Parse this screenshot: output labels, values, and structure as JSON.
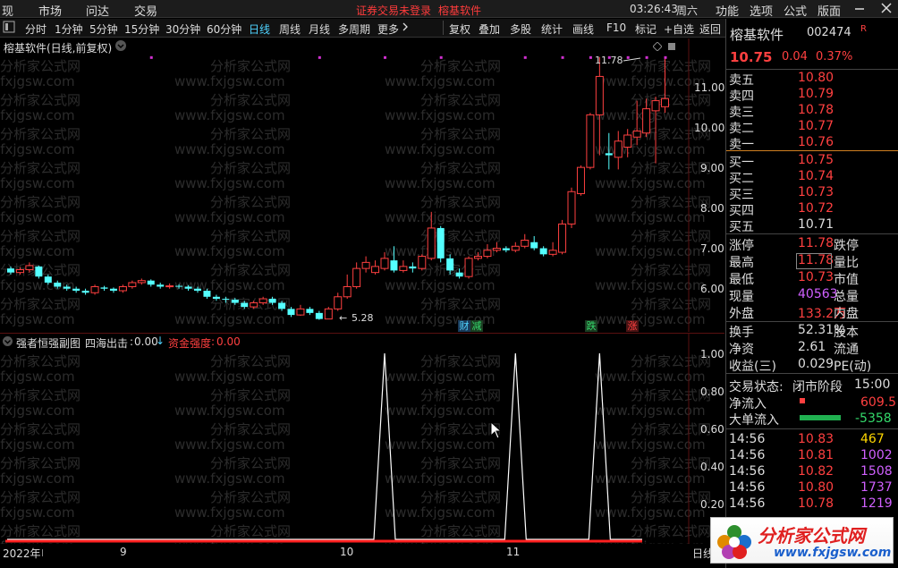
{
  "menubar": {
    "items": [
      "现",
      "市场",
      "问达",
      "交易"
    ],
    "notice": "证券交易未登录",
    "brand": "榕基软件",
    "time": "03:26:43",
    "weekday": "周六",
    "right_items": [
      "功能",
      "选项",
      "公式",
      "版面"
    ],
    "min_icon": "minimize-icon",
    "close_icon": "close-icon"
  },
  "toolbar": {
    "left_icon": "panel-toggle-icon",
    "periods": [
      "分时",
      "1分钟",
      "5分钟",
      "15分钟",
      "30分钟",
      "60分钟",
      "日线",
      "周线",
      "月线",
      "多周期",
      "更多"
    ],
    "active_period": "日线",
    "tools": [
      "复权",
      "叠加",
      "多股",
      "统计",
      "画线",
      "F10",
      "标记",
      "+自选",
      "返回"
    ]
  },
  "main_chart": {
    "title": "榕基软件(日线,前复权)",
    "y_ticks": [
      "11.00",
      "10.00",
      "9.00",
      "8.00",
      "7.00",
      "6.00"
    ],
    "high_label": "11.78",
    "low_label": "5.28",
    "event_tags": [
      {
        "text": "财",
        "color": "#4fd3ff"
      },
      {
        "text": "减",
        "color": "#34d96b"
      },
      {
        "text": "跌",
        "color": "#34d96b"
      },
      {
        "text": "涨",
        "color": "#ff4040"
      }
    ],
    "watermark": [
      "分析家公式网",
      "www.fxjgsw.com"
    ],
    "colors": {
      "up": "#ff4040",
      "down": "#54ffff",
      "marker": "#d030d0"
    }
  },
  "chart_data": {
    "type": "candlestick",
    "title": "榕基软件(日线,前复权)",
    "ylim": [
      5.0,
      12.0
    ],
    "open": [
      6.55,
      6.45,
      6.52,
      6.6,
      6.35,
      6.2,
      6.1,
      6.05,
      6.0,
      5.95,
      6.08,
      6.05,
      6.0,
      6.1,
      6.2,
      6.25,
      6.15,
      6.1,
      6.12,
      6.1,
      6.05,
      6.0,
      5.85,
      5.8,
      5.78,
      5.7,
      5.6,
      5.7,
      5.8,
      5.7,
      5.55,
      5.4,
      5.55,
      5.45,
      5.3,
      5.55,
      5.85,
      6.1,
      6.55,
      6.45,
      6.55,
      6.75,
      6.5,
      6.6,
      6.55,
      6.8,
      7.55,
      6.8,
      6.45,
      6.35,
      6.8,
      6.85,
      7.0,
      7.05,
      7.0,
      7.1,
      7.2,
      7.05,
      6.9,
      6.95,
      7.65,
      8.4,
      9.05,
      10.35,
      9.4,
      9.3,
      9.55,
      9.8,
      9.9,
      10.45,
      10.55
    ],
    "close": [
      6.45,
      6.52,
      6.62,
      6.35,
      6.2,
      6.1,
      6.05,
      6.0,
      5.95,
      6.1,
      6.05,
      6.0,
      6.1,
      6.2,
      6.25,
      6.15,
      6.1,
      6.12,
      6.1,
      6.05,
      6.0,
      5.85,
      5.8,
      5.78,
      5.7,
      5.6,
      5.7,
      5.8,
      5.7,
      5.55,
      5.4,
      5.55,
      5.45,
      5.3,
      5.55,
      5.85,
      6.1,
      6.55,
      6.7,
      6.6,
      6.8,
      6.5,
      6.6,
      6.55,
      6.85,
      7.55,
      6.8,
      6.5,
      6.35,
      6.8,
      6.85,
      7.0,
      7.05,
      7.0,
      7.1,
      7.25,
      7.05,
      6.9,
      7.0,
      7.65,
      8.45,
      9.05,
      10.35,
      11.3,
      9.35,
      9.7,
      9.85,
      9.95,
      10.5,
      10.7,
      10.75
    ],
    "high": [
      6.6,
      6.58,
      6.7,
      6.62,
      6.4,
      6.25,
      6.15,
      6.1,
      6.05,
      6.15,
      6.12,
      6.08,
      6.15,
      6.25,
      6.3,
      6.28,
      6.2,
      6.18,
      6.16,
      6.14,
      6.1,
      6.05,
      5.9,
      5.85,
      5.82,
      5.75,
      5.75,
      5.85,
      5.85,
      5.75,
      5.6,
      5.65,
      5.6,
      5.5,
      5.6,
      5.95,
      6.4,
      6.7,
      6.85,
      6.75,
      6.95,
      7.1,
      6.75,
      6.7,
      6.9,
      7.95,
      7.6,
      6.9,
      6.55,
      6.85,
      6.95,
      7.15,
      7.2,
      7.1,
      7.2,
      7.4,
      7.35,
      7.1,
      7.2,
      7.75,
      8.55,
      9.1,
      10.4,
      11.78,
      9.9,
      9.95,
      10.0,
      10.7,
      10.75,
      10.8,
      11.78
    ],
    "low": [
      6.4,
      6.4,
      6.45,
      6.3,
      6.15,
      6.05,
      6.0,
      5.95,
      5.9,
      5.9,
      6.0,
      5.95,
      5.95,
      6.05,
      6.15,
      6.1,
      6.05,
      6.05,
      6.05,
      6.0,
      5.95,
      5.8,
      5.75,
      5.7,
      5.65,
      5.55,
      5.55,
      5.65,
      5.65,
      5.5,
      5.35,
      5.38,
      5.4,
      5.28,
      5.3,
      5.5,
      5.8,
      6.05,
      6.45,
      6.4,
      6.5,
      6.45,
      6.45,
      6.45,
      6.5,
      6.75,
      6.7,
      6.4,
      6.3,
      6.3,
      6.75,
      6.8,
      6.95,
      6.95,
      6.95,
      7.05,
      7.0,
      6.85,
      6.85,
      6.9,
      7.55,
      8.35,
      9.0,
      9.35,
      9.0,
      9.0,
      9.3,
      9.6,
      9.8,
      9.15,
      10.4
    ],
    "markers_y": 11.8,
    "markers_x": [
      15,
      33,
      40,
      46,
      55,
      59,
      62,
      64,
      66,
      68,
      70
    ]
  },
  "sub_chart": {
    "title": "强者恒强副图",
    "item1_label": "四海出击",
    "item1_value": "0.00",
    "item2_label": "资金强度",
    "item2_value": "0.00",
    "y_ticks": [
      "1.00",
      "0.80",
      "0.60",
      "0.40",
      "0.20"
    ],
    "spikes": [
      {
        "x": 40,
        "value": 1.0
      },
      {
        "x": 54,
        "value": 1.0
      },
      {
        "x": 63,
        "value": 1.0
      }
    ]
  },
  "date_axis": {
    "labels": [
      "2022年",
      "9",
      "10",
      "11"
    ],
    "right_label": "日线"
  },
  "right_panel": {
    "stock_name": "榕基软件",
    "stock_code": "002474",
    "r_badge": "R",
    "price": "10.75",
    "change": "0.04",
    "change_pct": "0.37%",
    "asks": [
      {
        "label": "卖五",
        "price": "10.80"
      },
      {
        "label": "卖四",
        "price": "10.79"
      },
      {
        "label": "卖三",
        "price": "10.78"
      },
      {
        "label": "卖二",
        "price": "10.77"
      },
      {
        "label": "卖一",
        "price": "10.76"
      }
    ],
    "bids": [
      {
        "label": "买一",
        "price": "10.75"
      },
      {
        "label": "买二",
        "price": "10.74"
      },
      {
        "label": "买三",
        "price": "10.73"
      },
      {
        "label": "买四",
        "price": "10.72"
      },
      {
        "label": "买五",
        "price": "10.71"
      }
    ],
    "stats": [
      {
        "label": "涨停",
        "value": "11.78",
        "right": "跌停"
      },
      {
        "label": "最高",
        "value": "11.78",
        "right": "量比"
      },
      {
        "label": "最低",
        "value": "10.73",
        "right": "市值"
      },
      {
        "label": "现量",
        "value": "40563",
        "right": "总量"
      },
      {
        "label": "外盘",
        "value": "133.2万",
        "right": "内盘"
      }
    ],
    "stats2": [
      {
        "label": "换手",
        "value": "52.31%",
        "right": "股本"
      },
      {
        "label": "净资",
        "value": "2.61",
        "right": "流通"
      },
      {
        "label": "收益(三)",
        "value": "0.029",
        "right": "PE(动)"
      }
    ],
    "trade_status_label": "交易状态:",
    "trade_status": "闭市阶段",
    "trade_time": "15:00",
    "net_inflow_label": "净流入",
    "net_inflow": "609.5",
    "big_inflow_label": "大单流入",
    "big_inflow": "-5358",
    "ticks": [
      {
        "time": "14:56",
        "price": "10.83",
        "vol": "467"
      },
      {
        "time": "14:56",
        "price": "10.81",
        "vol": "1002"
      },
      {
        "time": "14:56",
        "price": "10.82",
        "vol": "1508"
      },
      {
        "time": "14:56",
        "price": "10.80",
        "vol": "1737"
      },
      {
        "time": "14:56",
        "price": "10.78",
        "vol": "1219"
      }
    ]
  },
  "logo": {
    "text": "分析家公式网",
    "url": "www.fxjgsw.com"
  }
}
